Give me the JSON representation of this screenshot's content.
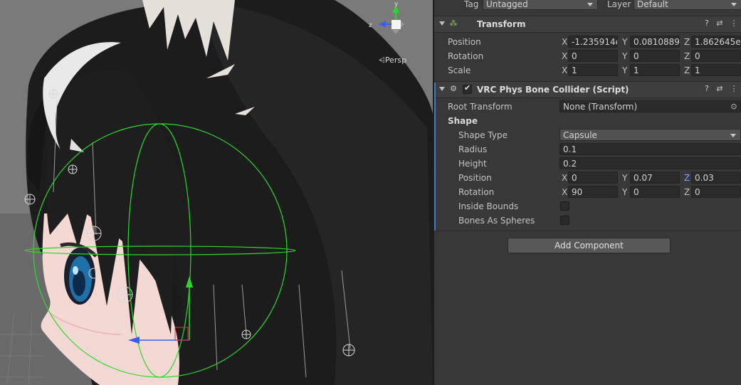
{
  "scene": {
    "projection_label": "Persp",
    "gizmo_axes": {
      "z": "z",
      "y": "y"
    }
  },
  "inspector": {
    "tag": {
      "label": "Tag",
      "value": "Untagged"
    },
    "layer": {
      "label": "Layer",
      "value": "Default"
    },
    "transform": {
      "title": "Transform",
      "position": {
        "label": "Position",
        "x": "-1.235914e",
        "y": "0.0810889",
        "z": "1.862645e-"
      },
      "rotation": {
        "label": "Rotation",
        "x": "0",
        "y": "0",
        "z": "0"
      },
      "scale": {
        "label": "Scale",
        "x": "1",
        "y": "1",
        "z": "1"
      }
    },
    "collider": {
      "title": "VRC Phys Bone Collider (Script)",
      "enabled": true,
      "root_transform": {
        "label": "Root Transform",
        "value": "None (Transform)"
      },
      "shape_section": "Shape",
      "shape_type": {
        "label": "Shape Type",
        "value": "Capsule"
      },
      "radius": {
        "label": "Radius",
        "value": "0.1"
      },
      "height": {
        "label": "Height",
        "value": "0.2"
      },
      "position": {
        "label": "Position",
        "x": "0",
        "y": "0.07",
        "z": "0.03"
      },
      "rotation": {
        "label": "Rotation",
        "x": "90",
        "y": "0",
        "z": "0"
      },
      "inside_bounds": {
        "label": "Inside Bounds",
        "checked": false
      },
      "bones_as_spheres": {
        "label": "Bones As Spheres",
        "checked": false
      }
    },
    "add_component_label": "Add Component",
    "axis_labels": {
      "x": "X",
      "y": "Y",
      "z": "Z"
    }
  },
  "colors": {
    "gizmo_green": "#2bd92b",
    "axis_blue": "#3a5cff",
    "hair": "#1b1b1b",
    "selection_blue": "#3d7cc9"
  }
}
